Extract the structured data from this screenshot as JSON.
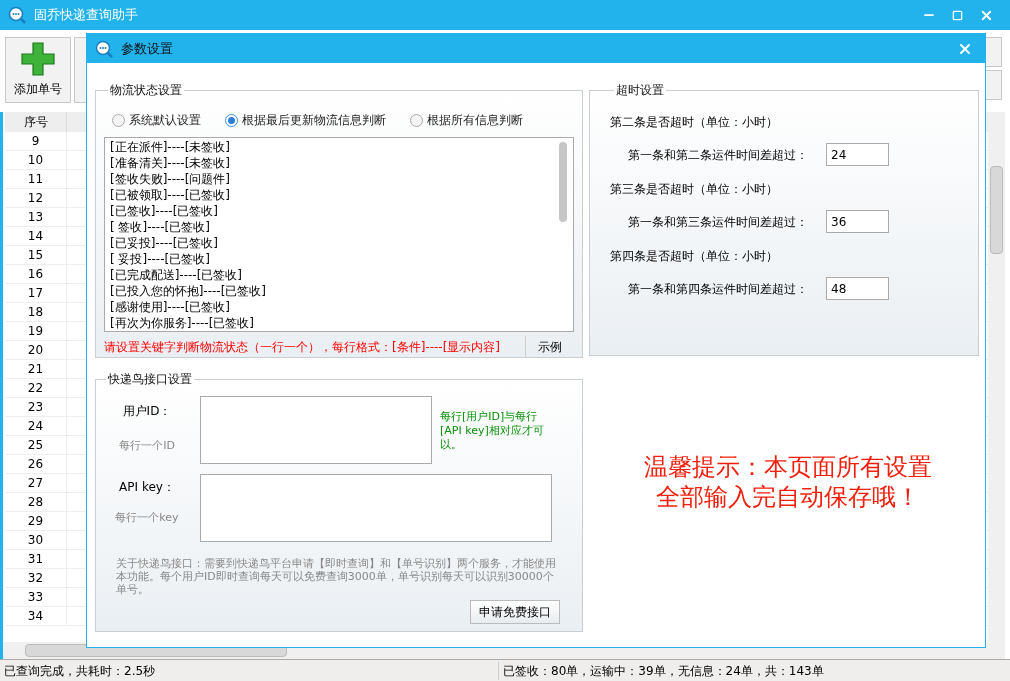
{
  "main_window": {
    "title": "固乔快递查询助手",
    "toolbar": [
      {
        "label": "添加单号"
      }
    ],
    "table": {
      "columns": [
        "序号"
      ],
      "rows": [
        "9",
        "10",
        "11",
        "12",
        "13",
        "14",
        "15",
        "16",
        "17",
        "18",
        "19",
        "20",
        "21",
        "22",
        "23",
        "24",
        "25",
        "26",
        "27",
        "28",
        "29",
        "30",
        "31",
        "32",
        "33",
        "34"
      ]
    },
    "status_bar": {
      "left": "已查询完成，共耗时：2.5秒",
      "right": "已签收：80单，运输中：39单，无信息：24单，共：143单"
    }
  },
  "dialog": {
    "title": "参数设置",
    "logistics": {
      "title": "物流状态设置",
      "options": [
        {
          "label": "系统默认设置",
          "selected": false
        },
        {
          "label": "根据最后更新物流信息判断",
          "selected": true
        },
        {
          "label": "根据所有信息判断",
          "selected": false
        }
      ],
      "rules": [
        "[正在派件]----[未签收]",
        "[准备清关]----[未签收]",
        "[签收失败]----[问题件]",
        "[已被领取]----[已签收]",
        "[已签收]----[已签收]",
        "[ 签收]----[已签收]",
        "[已妥投]----[已签收]",
        "[ 妥投]----[已签收]",
        "[已完成配送]----[已签收]",
        "[已投入您的怀抱]----[已签收]",
        "[感谢使用]----[已签收]",
        "[再次为你服务]----[已签收]"
      ],
      "hint": "请设置关键字判断物流状态（一行一个），每行格式：[条件]----[显示内容]",
      "example_button": "示例"
    },
    "timeout": {
      "title": "超时设置",
      "items": [
        {
          "heading": "第二条是否超时（单位：小时）",
          "label": "第一条和第二条运件时间差超过：",
          "value": "24"
        },
        {
          "heading": "第三条是否超时（单位：小时）",
          "label": "第一条和第三条运件时间差超过：",
          "value": "36"
        },
        {
          "heading": "第四条是否超时（单位：小时）",
          "label": "第一条和第四条运件时间差超过：",
          "value": "48"
        }
      ]
    },
    "kdniao": {
      "title": "快递鸟接口设置",
      "user_id": {
        "label": "用户ID：",
        "hint": "每行一个ID"
      },
      "api_key": {
        "label": "API key：",
        "hint": "每行一个key"
      },
      "note": "每行[用户ID]与每行[API key]相对应才可以。",
      "about": "关于快递鸟接口：需要到快递鸟平台申请【即时查询】和【单号识别】两个服务，才能使用本功能。每个用户ID即时查询每天可以免费查询3000单，单号识别每天可以识别30000个单号。",
      "apply_button": "申请免费接口"
    },
    "tip": [
      "温馨提示：本页面所有设置",
      "全部输入完自动保存哦！"
    ]
  }
}
